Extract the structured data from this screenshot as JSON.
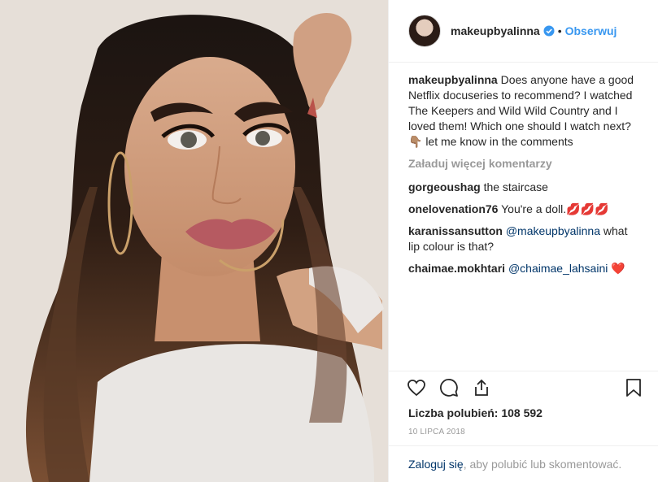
{
  "post": {
    "username": "makeupbyalinna",
    "dot": "•",
    "follow_label": "Obserwuj",
    "caption_user": "makeupbyalinna",
    "caption_text": "Does anyone have a good Netflix docuseries to recommend? I watched The Keepers and Wild Wild Country and I loved them! Which one should I watch next? 👇🏽 let me know in the comments",
    "load_more": "Załaduj więcej komentarzy"
  },
  "comments": [
    {
      "user": "gorgeoushag",
      "text": "the staircase"
    },
    {
      "user": "onelovenation76",
      "text": "You're a doll.💋💋💋"
    },
    {
      "user": "karanissansutton",
      "mention": "@makeupbyalinna",
      "text": " what lip colour is that?"
    },
    {
      "user": "chaimae.mokhtari",
      "mention": "@chaimae_lahsaini",
      "text": " ❤️"
    }
  ],
  "stats": {
    "likes": "Liczba polubień: 108 592",
    "date": "10 LIPCA 2018"
  },
  "footer": {
    "login": "Zaloguj się",
    "text": ", aby polubić lub skomentować."
  },
  "icons": [
    "heart-icon",
    "comment-icon",
    "share-icon",
    "bookmark-icon",
    "verified-icon"
  ],
  "colors": {
    "link": "#3897f0",
    "mention": "#003569",
    "muted": "#999999"
  }
}
